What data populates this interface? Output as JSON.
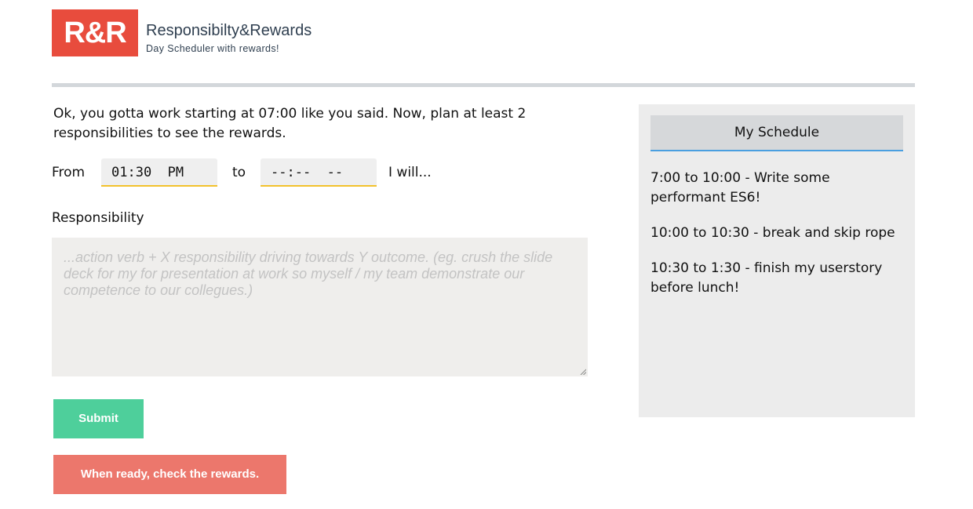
{
  "brand": {
    "logo_text": "R&R",
    "title": "Responsibilty&Rewards",
    "subtitle": "Day Scheduler with rewards!"
  },
  "form": {
    "intro": "Ok, you gotta work starting at 07:00 like you said. Now, plan at least 2 responsibilities to see the rewards.",
    "from_label": "From",
    "from_value": "01:30  PM",
    "to_label": "to",
    "to_value": "--:--  --",
    "will_label": "I will...",
    "responsibility_label": "Responsibility",
    "responsibility_placeholder": "...action verb + X responsibility driving towards Y outcome. (eg. crush the slide deck for my for presentation at work so myself / my team demonstrate our competence to our collegues.)",
    "submit_label": "Submit",
    "rewards_label": "When ready, check the rewards."
  },
  "schedule": {
    "title": "My Schedule",
    "items": [
      "7:00 to 10:00 - Write some performant ES6!",
      "10:00 to 10:30 - break and skip rope",
      "10:30 to 1:30 - finish my userstory before lunch!"
    ]
  },
  "colors": {
    "brand_red": "#e84c3d",
    "submit_green": "#4ecf9b",
    "rewards_red": "#ec776c",
    "input_underline": "#f2c22c",
    "schedule_accent": "#4a9fe0"
  }
}
